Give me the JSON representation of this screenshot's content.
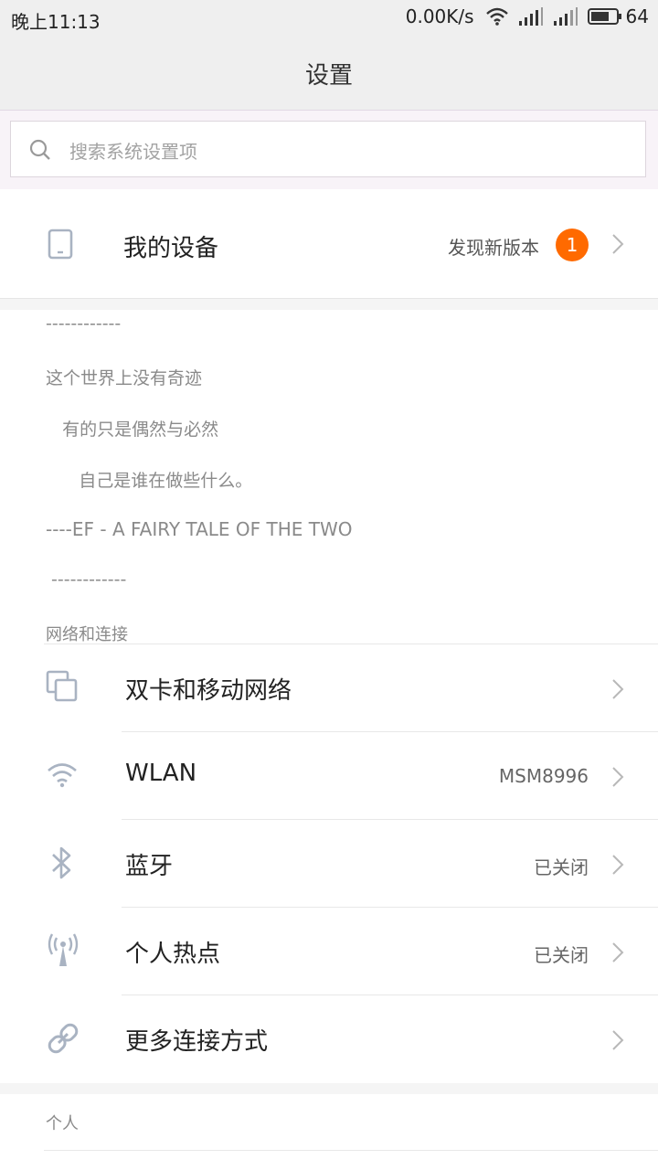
{
  "status_bar": {
    "time": "晚上11:13",
    "network_speed": "0.00K/s",
    "battery": "64",
    "icons": [
      "wifi-icon",
      "signal-icon",
      "signal-icon",
      "battery-icon"
    ]
  },
  "header": {
    "title": "设置"
  },
  "search": {
    "placeholder": "搜索系统设置项",
    "icon": "search-icon"
  },
  "my_device": {
    "label": "我的设备",
    "status": "发现新版本",
    "badge": "1",
    "icon": "phone-icon"
  },
  "quote": {
    "lines": [
      "------------",
      "这个世界上没有奇迹",
      "   有的只是偶然与必然",
      "      自己是谁在做些什么。",
      "----EF - A FAIRY TALE OF THE TWO",
      " ------------"
    ]
  },
  "network_section": {
    "header": "网络和连接",
    "items": [
      {
        "label": "双卡和移动网络",
        "value": "",
        "icon": "dual-sim-icon"
      },
      {
        "label": "WLAN",
        "value": "MSM8996",
        "icon": "wifi-icon"
      },
      {
        "label": "蓝牙",
        "value": "已关闭",
        "icon": "bluetooth-icon"
      },
      {
        "label": "个人热点",
        "value": "已关闭",
        "icon": "hotspot-icon"
      },
      {
        "label": "更多连接方式",
        "value": "",
        "icon": "link-icon"
      }
    ]
  },
  "personal_section": {
    "header": "个人"
  },
  "colors": {
    "accent_badge": "#ff6a00",
    "icon_gray": "#a9b3c2",
    "background": "#efefef"
  }
}
